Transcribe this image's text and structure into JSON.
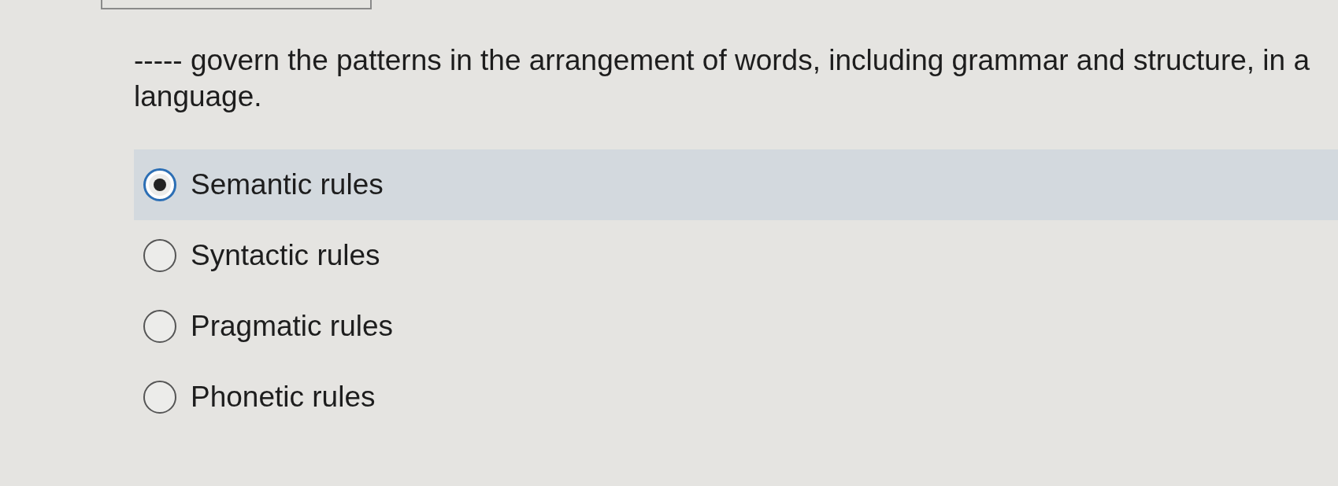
{
  "question": "----- govern the patterns in the arrangement of words, including grammar and structure, in a language.",
  "options": [
    {
      "label": "Semantic rules",
      "selected": true
    },
    {
      "label": "Syntactic rules",
      "selected": false
    },
    {
      "label": "Pragmatic rules",
      "selected": false
    },
    {
      "label": "Phonetic rules",
      "selected": false
    }
  ]
}
